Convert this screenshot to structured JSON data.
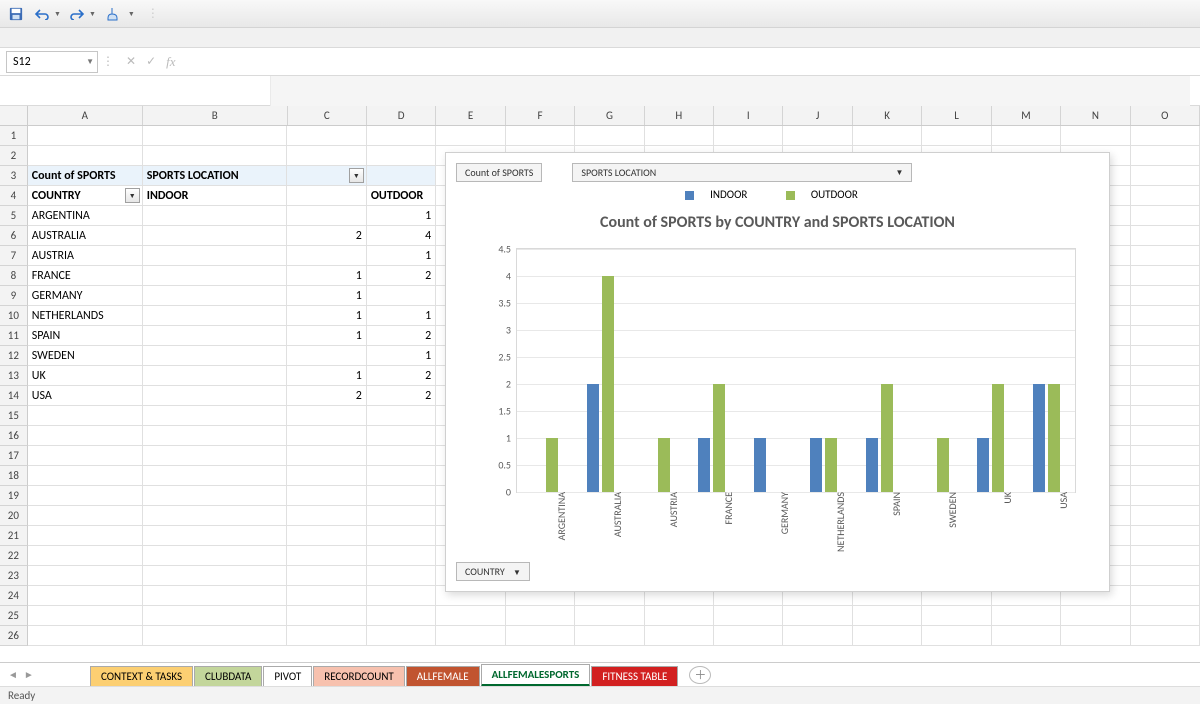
{
  "qat": {
    "save": "save",
    "undo": "undo",
    "redo": "redo",
    "touch": "touch"
  },
  "name_box": "S12",
  "formula": "",
  "columns": [
    "A",
    "B",
    "C",
    "D",
    "E",
    "F",
    "G",
    "H",
    "I",
    "J",
    "K",
    "L",
    "M",
    "N",
    "O"
  ],
  "row_count": 26,
  "pivot": {
    "measure_label": "Count of SPORTS",
    "col_field": "SPORTS LOCATION",
    "row_field": "COUNTRY",
    "cols": [
      "INDOOR",
      "OUTDOOR"
    ],
    "rows": [
      {
        "country": "ARGENTINA",
        "indoor": "",
        "outdoor": "1"
      },
      {
        "country": "AUSTRALIA",
        "indoor": "2",
        "outdoor": "4"
      },
      {
        "country": "AUSTRIA",
        "indoor": "",
        "outdoor": "1"
      },
      {
        "country": "FRANCE",
        "indoor": "1",
        "outdoor": "2"
      },
      {
        "country": "GERMANY",
        "indoor": "1",
        "outdoor": ""
      },
      {
        "country": "NETHERLANDS",
        "indoor": "1",
        "outdoor": "1"
      },
      {
        "country": "SPAIN",
        "indoor": "1",
        "outdoor": "2"
      },
      {
        "country": "SWEDEN",
        "indoor": "",
        "outdoor": "1"
      },
      {
        "country": "UK",
        "indoor": "1",
        "outdoor": "2"
      },
      {
        "country": "USA",
        "indoor": "2",
        "outdoor": "2"
      }
    ]
  },
  "chart": {
    "measure_btn": "Count of SPORTS",
    "location_btn": "SPORTS LOCATION",
    "legend": {
      "indoor": "INDOOR",
      "outdoor": "OUTDOOR"
    },
    "title": "Count of SPORTS by COUNTRY and SPORTS LOCATION",
    "country_btn": "COUNTRY"
  },
  "chart_data": {
    "type": "bar",
    "title": "Count of SPORTS by COUNTRY and SPORTS LOCATION",
    "xlabel": "",
    "ylabel": "",
    "ylim": [
      0,
      4.5
    ],
    "yticks": [
      0,
      0.5,
      1,
      1.5,
      2,
      2.5,
      3,
      3.5,
      4,
      4.5
    ],
    "categories": [
      "ARGENTINA",
      "AUSTRALIA",
      "AUSTRIA",
      "FRANCE",
      "GERMANY",
      "NETHERLANDS",
      "SPAIN",
      "SWEDEN",
      "UK",
      "USA"
    ],
    "series": [
      {
        "name": "INDOOR",
        "values": [
          0,
          2,
          0,
          1,
          1,
          1,
          1,
          0,
          1,
          2
        ],
        "color": "#4f81bd"
      },
      {
        "name": "OUTDOOR",
        "values": [
          1,
          4,
          1,
          2,
          0,
          1,
          2,
          1,
          2,
          2
        ],
        "color": "#9bbb59"
      }
    ]
  },
  "tabs": {
    "context": "CONTEXT & TASKS",
    "clubdata": "CLUBDATA",
    "pivot": "PIVOT",
    "recordcount": "RECORDCOUNT",
    "allfemale": "ALLFEMALE",
    "allfemalesports": "ALLFEMALESPORTS",
    "fitness": "FITNESS TABLE"
  },
  "status": "Ready"
}
